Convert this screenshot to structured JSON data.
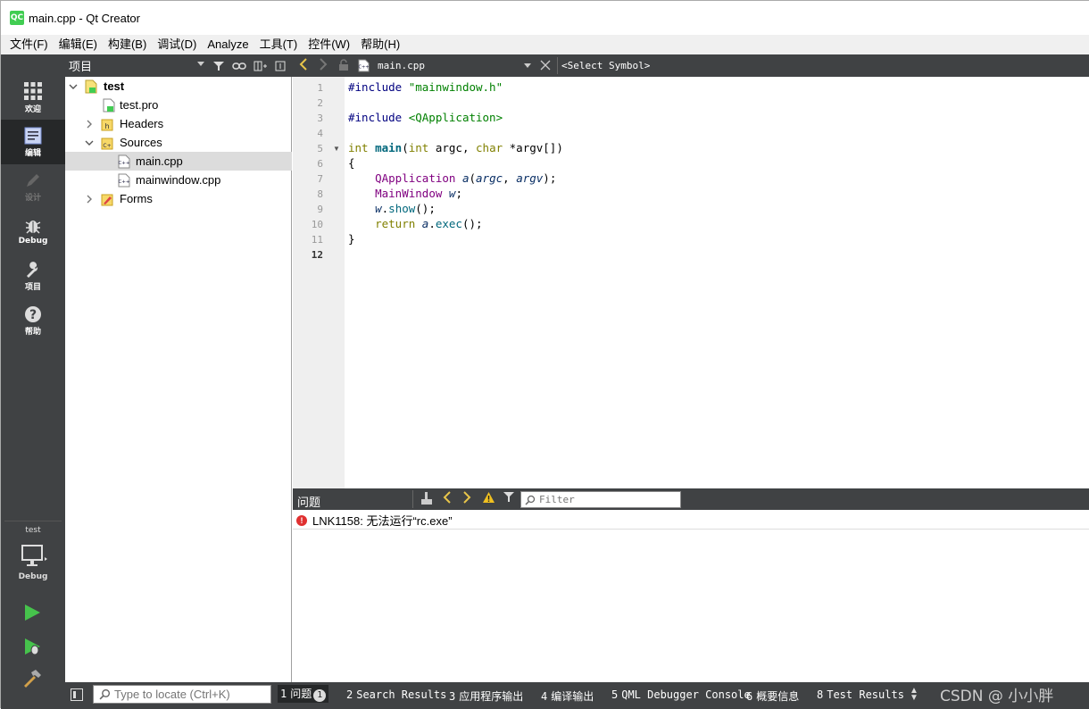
{
  "window": {
    "title": "main.cpp - Qt Creator",
    "app_icon": "QC"
  },
  "menu": [
    "文件(F)",
    "编辑(E)",
    "构建(B)",
    "调试(D)",
    "Analyze",
    "工具(T)",
    "控件(W)",
    "帮助(H)"
  ],
  "modes": [
    {
      "label": "欢迎",
      "icon": "grid-icon"
    },
    {
      "label": "编辑",
      "icon": "edit-doc-icon",
      "active": true
    },
    {
      "label": "设计",
      "icon": "pencil-icon",
      "disabled": true
    },
    {
      "label": "Debug",
      "icon": "bug-icon"
    },
    {
      "label": "项目",
      "icon": "wrench-icon"
    },
    {
      "label": "帮助",
      "icon": "help-icon"
    }
  ],
  "kit": {
    "project": "test",
    "config": "Debug"
  },
  "project_pane": {
    "title": "项目",
    "tree": [
      {
        "label": "test",
        "bold": true,
        "level": 0,
        "expanded": true,
        "icon": "qt-project-icon"
      },
      {
        "label": "test.pro",
        "level": 1,
        "icon": "pro-file-icon"
      },
      {
        "label": "Headers",
        "level": 1,
        "collapsed": true,
        "icon": "header-folder-icon"
      },
      {
        "label": "Sources",
        "level": 1,
        "expanded": true,
        "icon": "source-folder-icon"
      },
      {
        "label": "main.cpp",
        "level": 2,
        "selected": true,
        "icon": "cpp-file-icon"
      },
      {
        "label": "mainwindow.cpp",
        "level": 2,
        "icon": "cpp-file-icon"
      },
      {
        "label": "Forms",
        "level": 1,
        "collapsed": true,
        "icon": "forms-folder-icon"
      }
    ]
  },
  "editor": {
    "file": "main.cpp",
    "symbol": "<Select Symbol>",
    "current_line": 12,
    "line_numbers": [
      "1",
      "2",
      "3",
      "4",
      "5",
      "6",
      "7",
      "8",
      "9",
      "10",
      "11",
      "12"
    ]
  },
  "issues": {
    "title": "问题",
    "filter_placeholder": "Filter",
    "items": [
      {
        "text": "LNK1158: 无法运行“rc.exe”",
        "severity": "error"
      }
    ]
  },
  "statusbar": {
    "locator_placeholder": "Type to locate (Ctrl+K)",
    "tabs": [
      {
        "num": "1",
        "label": "问题",
        "count": "1",
        "active": true
      },
      {
        "num": "2",
        "label": "Search Results"
      },
      {
        "num": "3",
        "label": "应用程序输出"
      },
      {
        "num": "4",
        "label": "编译输出"
      },
      {
        "num": "5",
        "label": "QML Debugger Console"
      },
      {
        "num": "6",
        "label": "概要信息"
      },
      {
        "num": "8",
        "label": "Test Results"
      }
    ],
    "watermark": "CSDN @ 小小胖"
  },
  "colors": {
    "sidebar": "#404244",
    "active_mode": "#262829",
    "qt_green": "#41cd52",
    "error": "#e03030"
  }
}
